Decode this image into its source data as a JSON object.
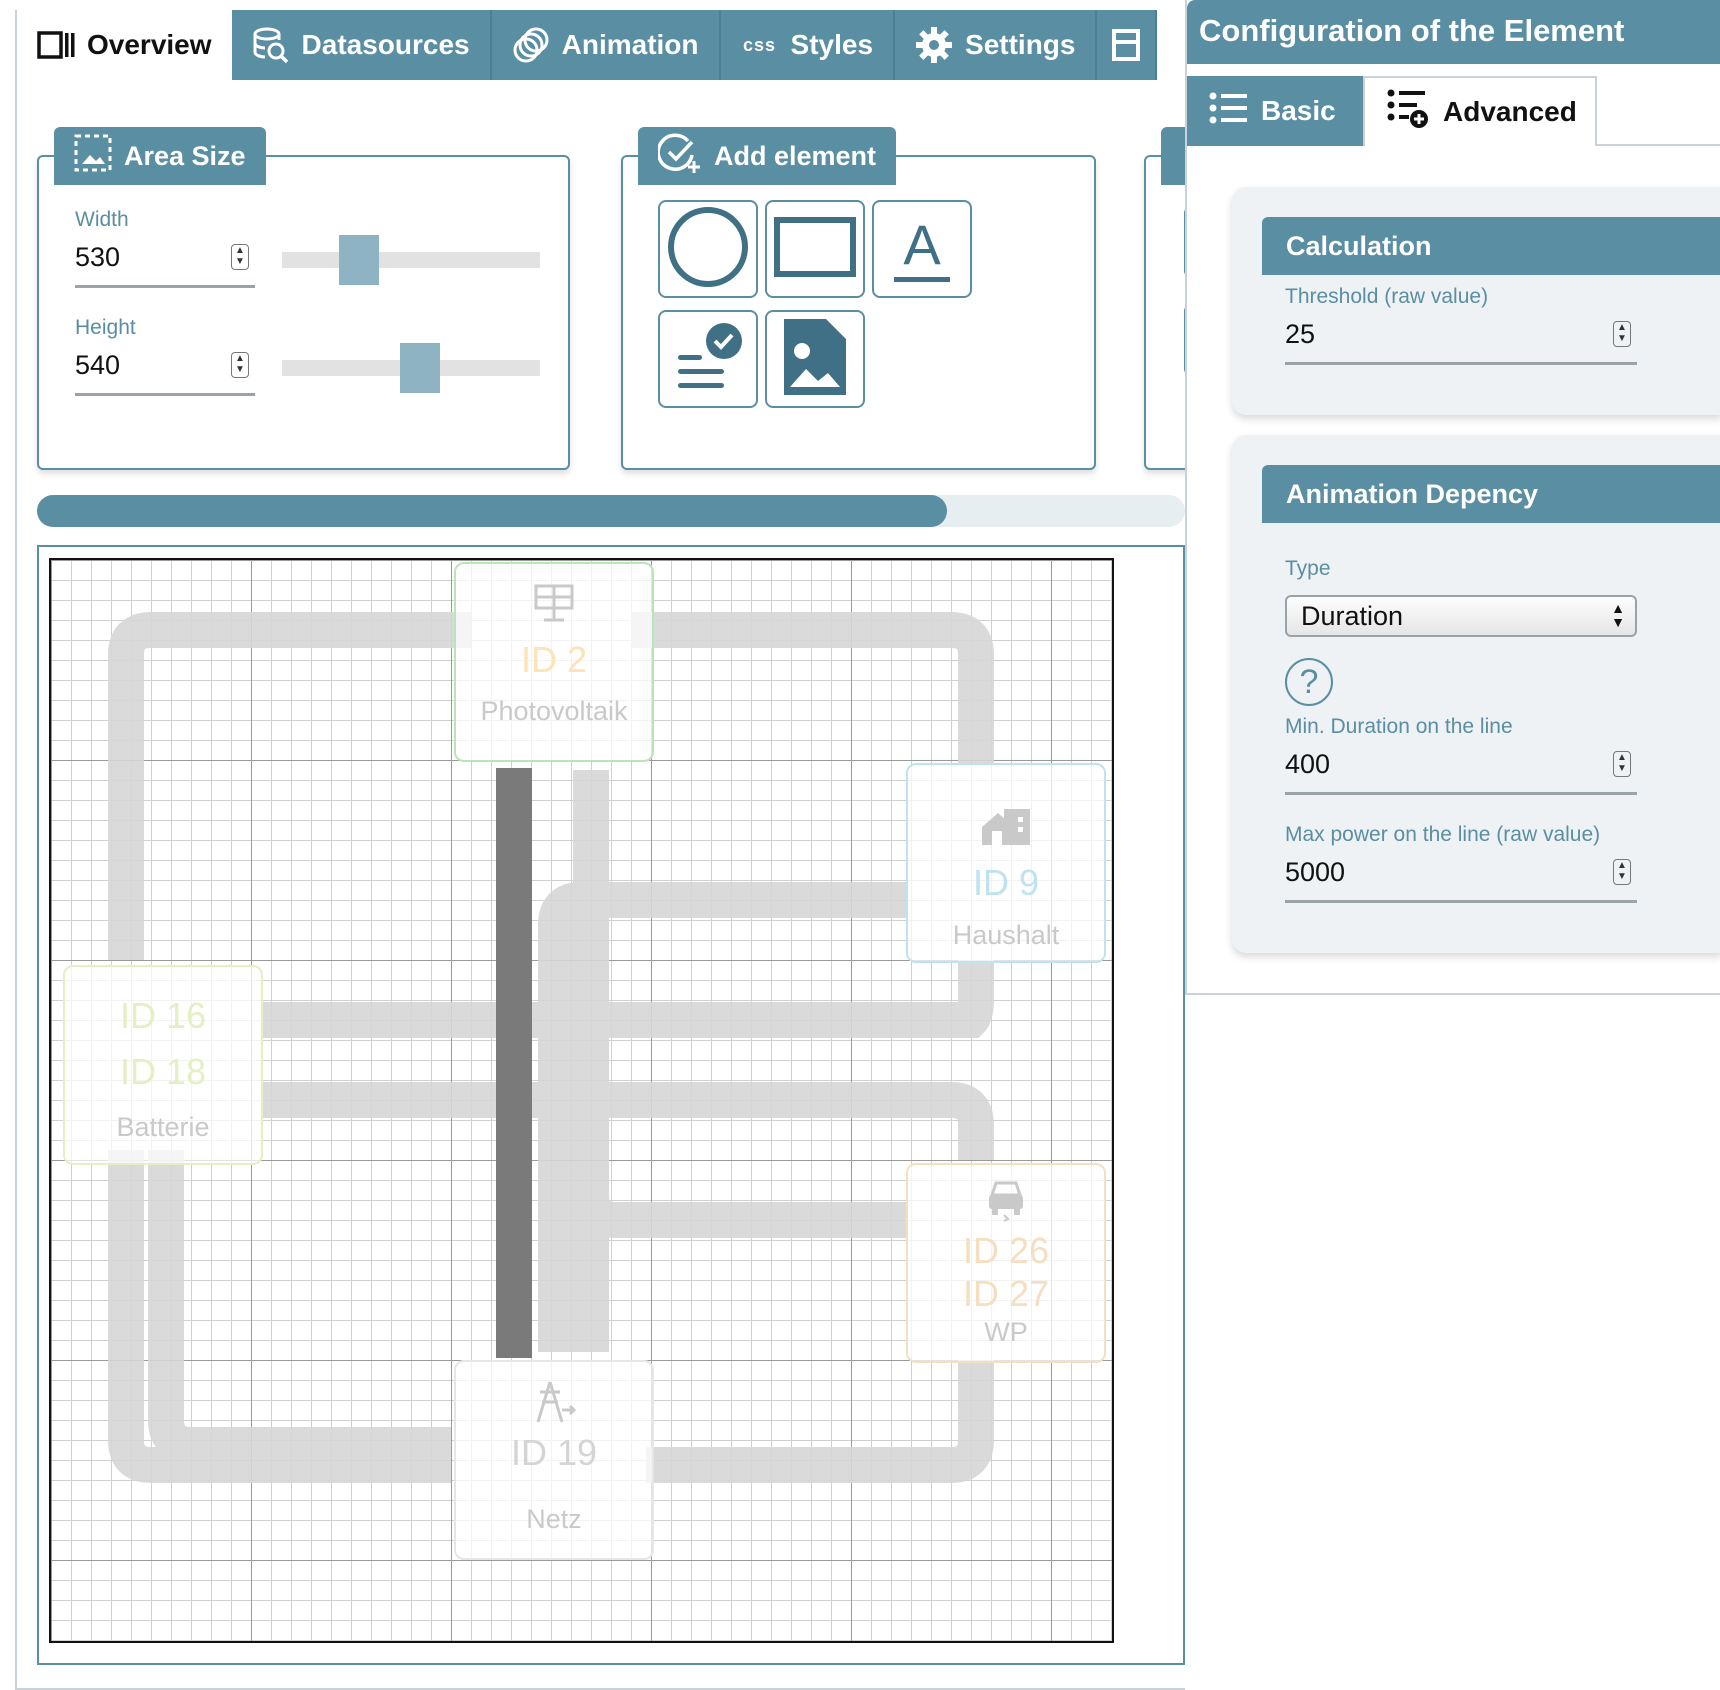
{
  "tabs": [
    {
      "label": "Overview",
      "icon": "columns-icon",
      "active": true
    },
    {
      "label": "Datasources",
      "icon": "database-search-icon"
    },
    {
      "label": "Animation",
      "icon": "animation-rings-icon"
    },
    {
      "label": "Styles",
      "icon": "css-icon",
      "icon_text": "css"
    },
    {
      "label": "Settings",
      "icon": "gear-icon"
    }
  ],
  "area_size": {
    "title": "Area Size",
    "width_label": "Width",
    "width_value": "530",
    "height_label": "Height",
    "height_value": "540"
  },
  "add_element": {
    "title": "Add element",
    "buttons": [
      "circle-icon",
      "rectangle-icon",
      "text-icon",
      "datasource-text-icon",
      "image-icon"
    ],
    "text_glyph": "A"
  },
  "canvas": {
    "nodes": [
      {
        "id_lines": [
          "ID 2"
        ],
        "name": "Photovoltaik",
        "icon": "solar-panel-icon",
        "color": "#b9e6b4",
        "id_color": "#fde3b5"
      },
      {
        "id_lines": [
          "ID 9"
        ],
        "name": "Haushalt",
        "icon": "house-icon",
        "color": "#bfe2f1",
        "id_color": "#bfe2f1"
      },
      {
        "id_lines": [
          "ID 16",
          "ID 18"
        ],
        "name": "Batterie",
        "icon": "",
        "color": "#e4f0c2",
        "id_color": "#e4f0c2"
      },
      {
        "id_lines": [
          "ID 26",
          "ID 27"
        ],
        "name": "WP",
        "icon": "car-icon",
        "color": "#f6dfc1",
        "id_color": "#f6dfc1"
      },
      {
        "id_lines": [
          "ID 19"
        ],
        "name": "Netz",
        "icon": "power-tower-icon",
        "color": "#e6e6e6",
        "id_color": "#d4d4d4"
      }
    ]
  },
  "config": {
    "title": "Configuration of the Element",
    "tabs": {
      "basic": "Basic",
      "advanced": "Advanced"
    },
    "calculation": {
      "title": "Calculation",
      "threshold_label": "Threshold (raw value)",
      "threshold_value": "25"
    },
    "animation_dependency": {
      "title": "Animation Depency",
      "type_label": "Type",
      "type_value": "Duration",
      "min_duration_label": "Min. Duration on the line",
      "min_duration_value": "400",
      "max_power_label": "Max power on the line (raw value)",
      "max_power_value": "5000"
    }
  },
  "colors": {
    "accent": "#5a8ea3",
    "selected_line": "#7a7a7a",
    "line": "#d6d6d6"
  }
}
